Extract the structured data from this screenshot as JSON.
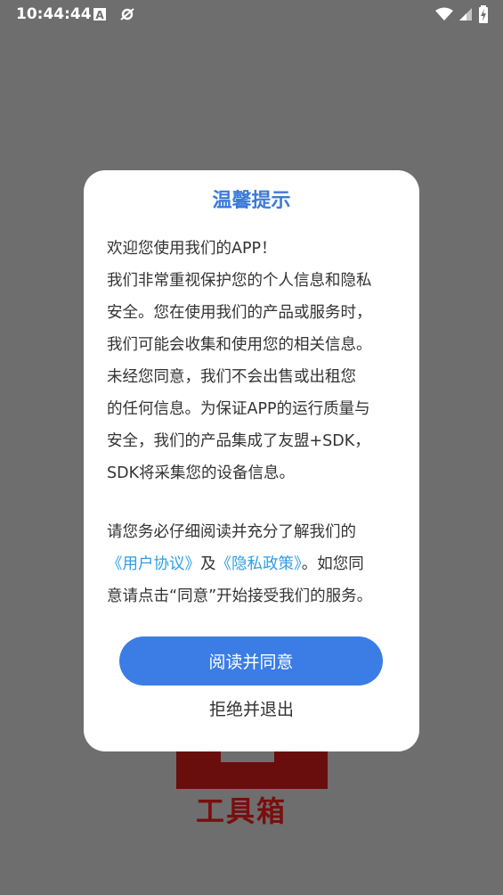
{
  "status_bar": {
    "time": "10:44:44",
    "left_icons": [
      "font-a-icon",
      "sync-off-icon"
    ],
    "right_icons": [
      "wifi-icon",
      "signal-icon",
      "battery-charging-icon"
    ]
  },
  "background": {
    "logo_text": "工具箱"
  },
  "dialog": {
    "title": "温馨提示",
    "paragraph1": [
      "欢迎您使用我们的APP！",
      "我们非常重视保护您的个人信息和隐私",
      "安全。您在使用我们的产品或服务时，",
      "我们可能会收集和使用您的相关信息。",
      "未经您同意，我们不会出售或出租您",
      "的任何信息。为保证APP的运行质量与",
      "安全，我们的产品集成了友盟+SDK，",
      "SDK将采集您的设备信息。"
    ],
    "paragraph2_line1": "请您务必仔细阅读并充分了解我们的",
    "user_agreement_link": "《用户协议》",
    "and_text": "及",
    "privacy_policy_link": "《隐私政策》",
    "paragraph2_line2_tail": "。如您同",
    "paragraph2_line3": "意请点击“同意”开始接受我们的服务。",
    "agree_button": "阅读并同意",
    "decline_button": "拒绝并退出"
  },
  "colors": {
    "scrim": "#6e6e6e",
    "accent": "#3b7de5",
    "title": "#3b7ad9",
    "link": "#2e9ee6",
    "logo": "#7a0e0e"
  }
}
